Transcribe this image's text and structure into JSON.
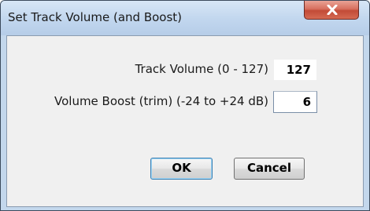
{
  "window": {
    "title": "Set Track Volume (and Boost)",
    "close_icon": "close-x-icon"
  },
  "track_volume": {
    "label": "Track Volume (0 - 127)",
    "value": "127"
  },
  "volume_boost": {
    "label": "Volume Boost (trim)  (-24 to +24 dB)",
    "value": "6"
  },
  "buttons": {
    "ok_label": "OK",
    "cancel_label": "Cancel"
  },
  "colors": {
    "close_button": "#c9533e",
    "frame": "#c3d7ec",
    "client": "#f0f0f0"
  }
}
